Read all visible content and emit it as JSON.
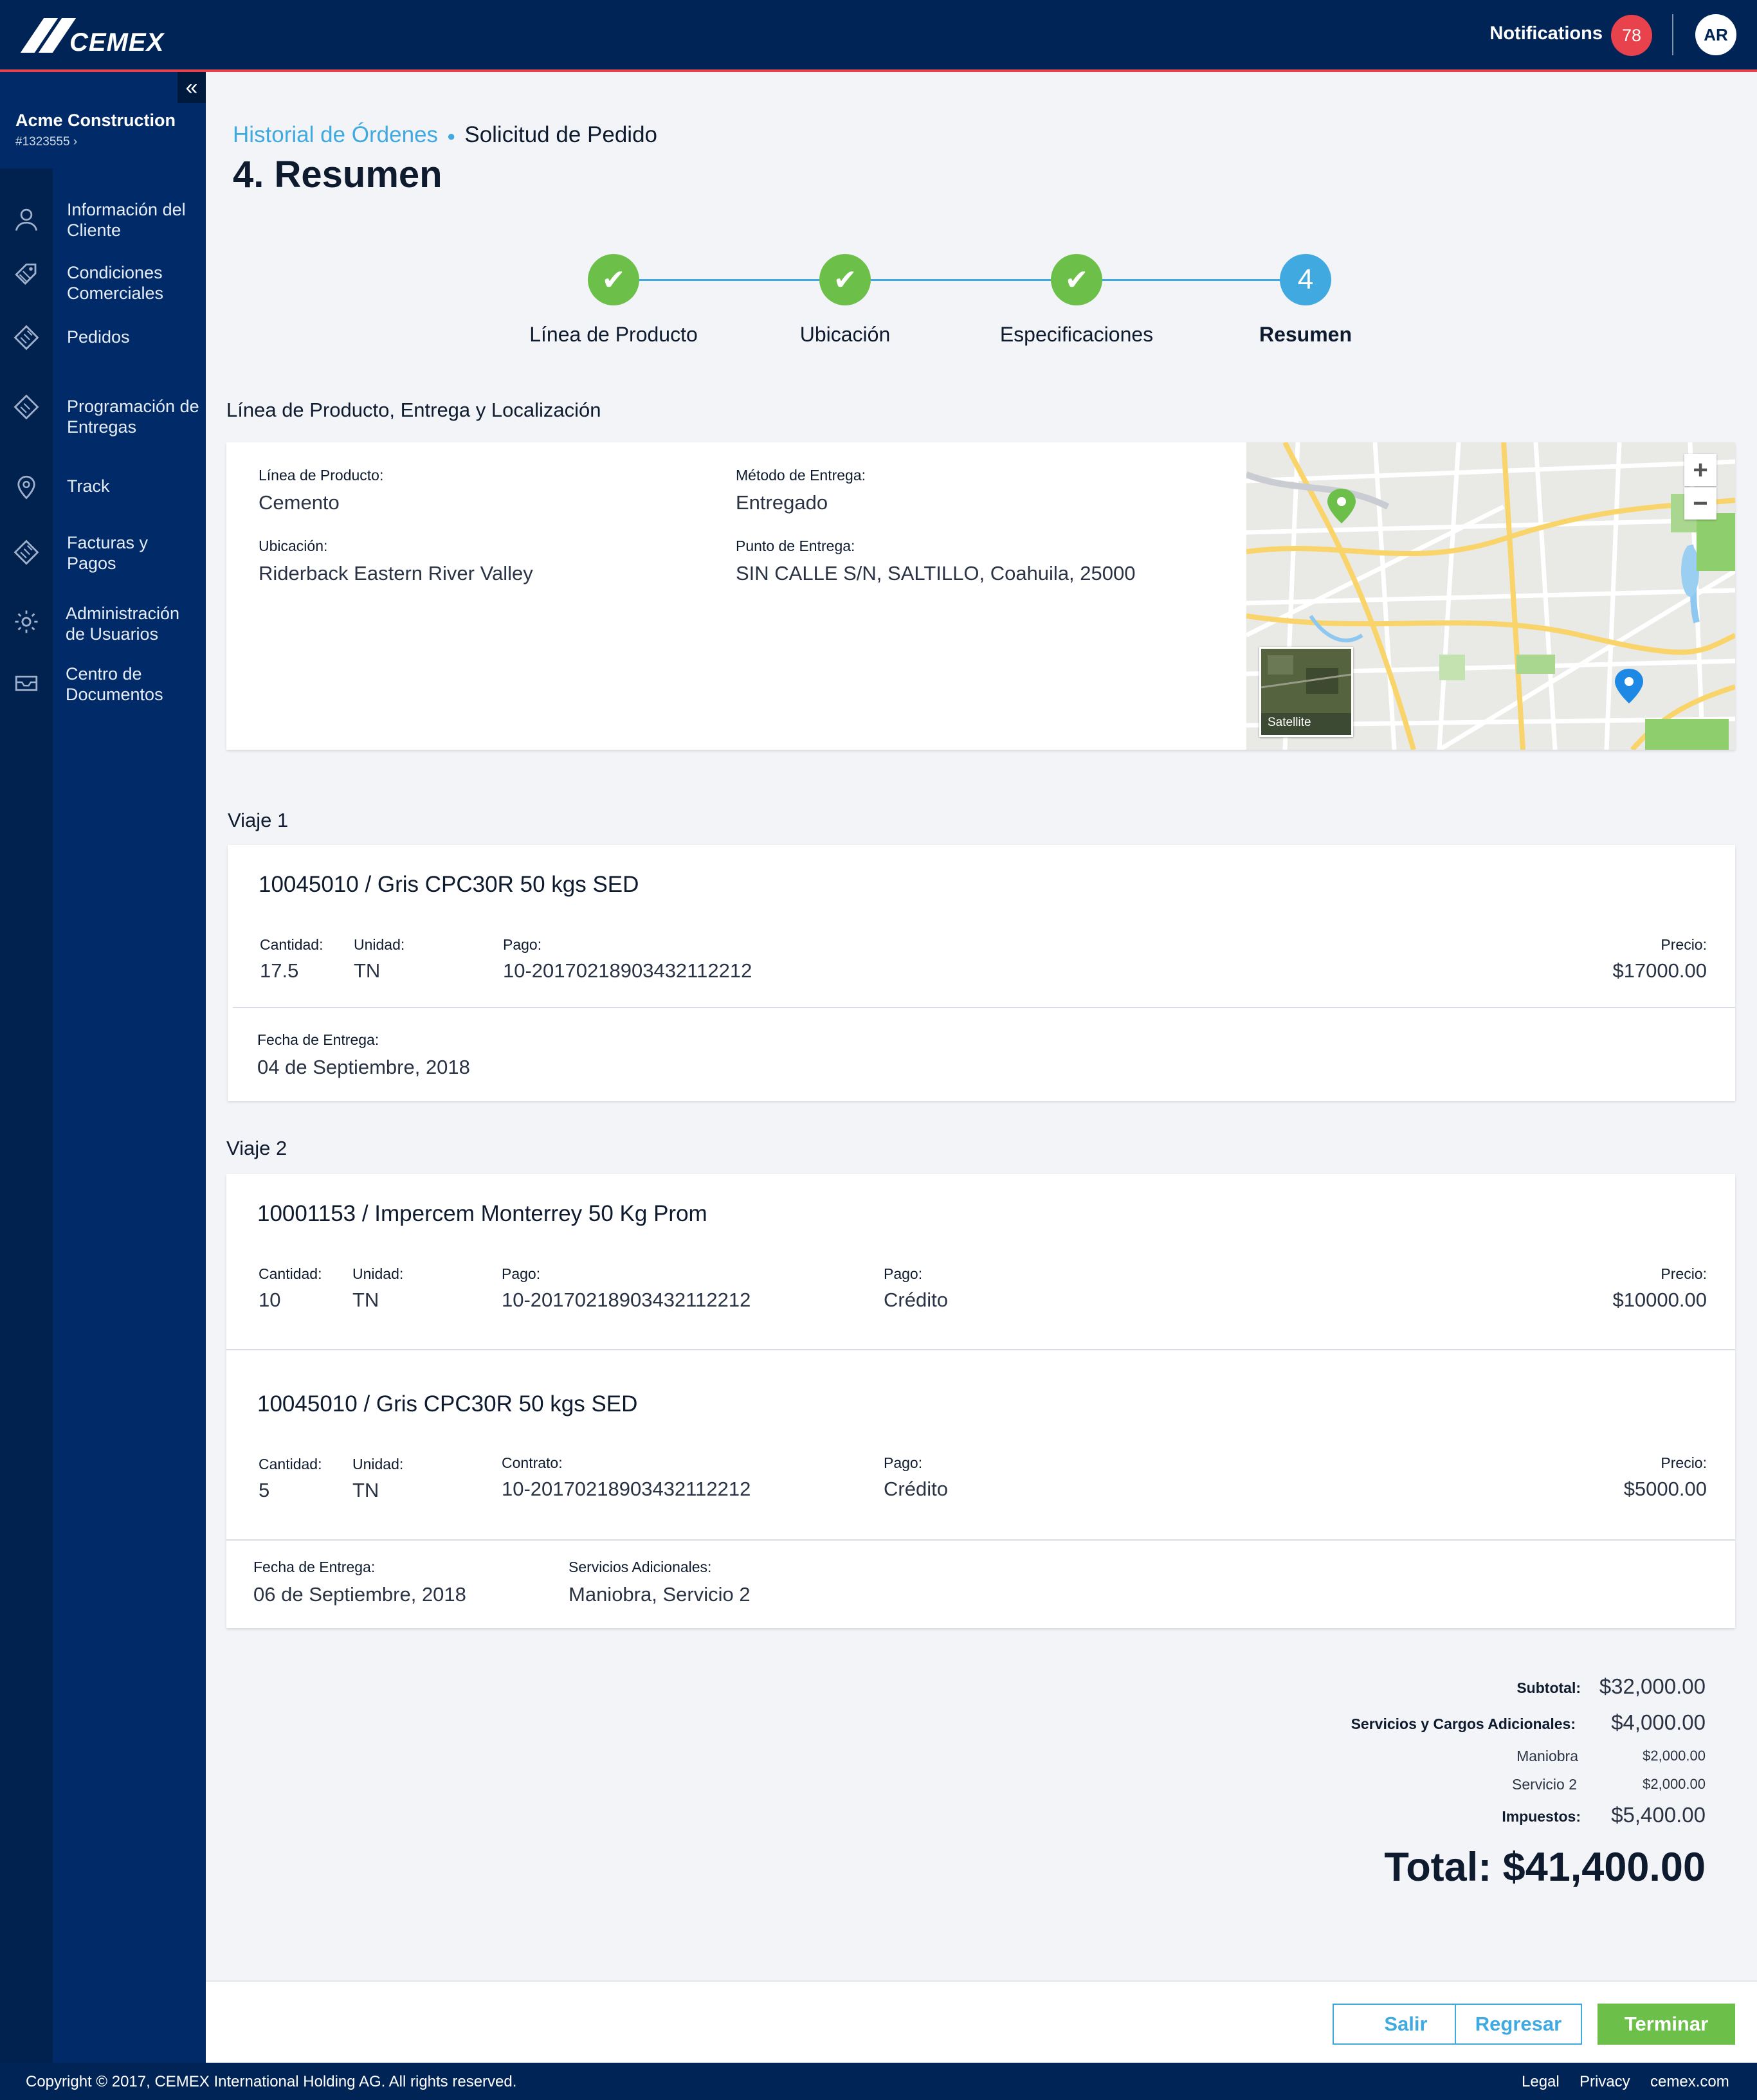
{
  "header": {
    "logo_text": "CEMEX",
    "notifications_label": "Notifications",
    "notifications_count": "78",
    "avatar_initials": "AR"
  },
  "sidebar": {
    "collapse_symbol": "«",
    "company_name": "Acme Construction",
    "company_id": "#1323555",
    "items": [
      {
        "label": "Información del Cliente",
        "icon": "user-icon"
      },
      {
        "label": "Condiciones Comerciales",
        "icon": "tag-icon"
      },
      {
        "label": "Pedidos",
        "icon": "layers-icon"
      },
      {
        "label": "Programación de Entregas",
        "icon": "layers-icon"
      },
      {
        "label": "Track",
        "icon": "location-pin-icon"
      },
      {
        "label": "Facturas y Pagos",
        "icon": "layers-icon"
      },
      {
        "label": "Administración de Usuarios",
        "icon": "gear-icon"
      },
      {
        "label": "Centro de Documentos",
        "icon": "inbox-icon"
      }
    ]
  },
  "breadcrumb": {
    "link": "Historial de Órdenes",
    "current": "Solicitud de Pedido"
  },
  "page_title": "4. Resumen",
  "stepper": {
    "steps": [
      {
        "label": "Línea de Producto",
        "state": "done"
      },
      {
        "label": "Ubicación",
        "state": "done"
      },
      {
        "label": "Especificaciones",
        "state": "done"
      },
      {
        "label": "Resumen",
        "state": "active",
        "number": "4"
      }
    ]
  },
  "delivery": {
    "section_title": "Línea de Producto, Entrega y Localización",
    "product_line_label": "Línea de Producto:",
    "product_line_value": "Cemento",
    "delivery_method_label": "Método de Entrega:",
    "delivery_method_value": "Entregado",
    "location_label": "Ubicación:",
    "location_value": "Riderback Eastern River Valley",
    "delivery_point_label": "Punto de Entrega:",
    "delivery_point_value": "SIN CALLE S/N, SALTILLO, Coahuila, 25000",
    "map": {
      "zoom_in": "+",
      "zoom_out": "−",
      "satellite_label": "Satellite"
    }
  },
  "trips": [
    {
      "title": "Viaje 1",
      "items": [
        {
          "name": "10045010 / Gris CPC30R 50 kgs SED",
          "quantity_label": "Cantidad:",
          "quantity": "17.5",
          "unit_label": "Unidad:",
          "unit": "TN",
          "ref_label": "Pago:",
          "ref": "10-20170218903432112212",
          "price_label": "Precio:",
          "price": "$17000.00"
        }
      ],
      "delivery_date_label": "Fecha de Entrega:",
      "delivery_date": "04 de Septiembre, 2018"
    },
    {
      "title": "Viaje 2",
      "items": [
        {
          "name": "10001153 / Impercem Monterrey 50 Kg Prom",
          "quantity_label": "Cantidad:",
          "quantity": "10",
          "unit_label": "Unidad:",
          "unit": "TN",
          "ref_label": "Pago:",
          "ref": "10-20170218903432112212",
          "payment_label": "Pago:",
          "payment": "Crédito",
          "price_label": "Precio:",
          "price": "$10000.00"
        },
        {
          "name": "10045010 / Gris CPC30R 50 kgs SED",
          "quantity_label": "Cantidad:",
          "quantity": "5",
          "unit_label": "Unidad:",
          "unit": "TN",
          "ref_label": "Contrato:",
          "ref": "10-20170218903432112212",
          "payment_label": "Pago:",
          "payment": "Crédito",
          "price_label": "Precio:",
          "price": "$5000.00"
        }
      ],
      "delivery_date_label": "Fecha de Entrega:",
      "delivery_date": "06 de Septiembre, 2018",
      "services_label": "Servicios Adicionales:",
      "services": "Maniobra, Servicio 2"
    }
  ],
  "summary": {
    "subtotal_label": "Subtotal:",
    "subtotal": "$32,000.00",
    "extras_label": "Servicios y Cargos Adicionales:",
    "extras": "$4,000.00",
    "extra_items": [
      {
        "label": "Maniobra",
        "value": "$2,000.00"
      },
      {
        "label": "Servicio 2",
        "value": "$2,000.00"
      }
    ],
    "taxes_label": "Impuestos:",
    "taxes": "$5,400.00",
    "total": "Total: $41,400.00"
  },
  "actions": {
    "exit": "Salir",
    "back": "Regresar",
    "finish": "Terminar"
  },
  "footer": {
    "copyright": "Copyright © 2017, CEMEX International Holding AG. All rights reserved.",
    "links": [
      "Legal",
      "Privacy",
      "cemex.com"
    ]
  },
  "colors": {
    "navy": "#012457",
    "sidebar": "#012b68",
    "accent_blue": "#3fa9e0",
    "success_green": "#6cc04a",
    "alert_red": "#e8424c"
  }
}
